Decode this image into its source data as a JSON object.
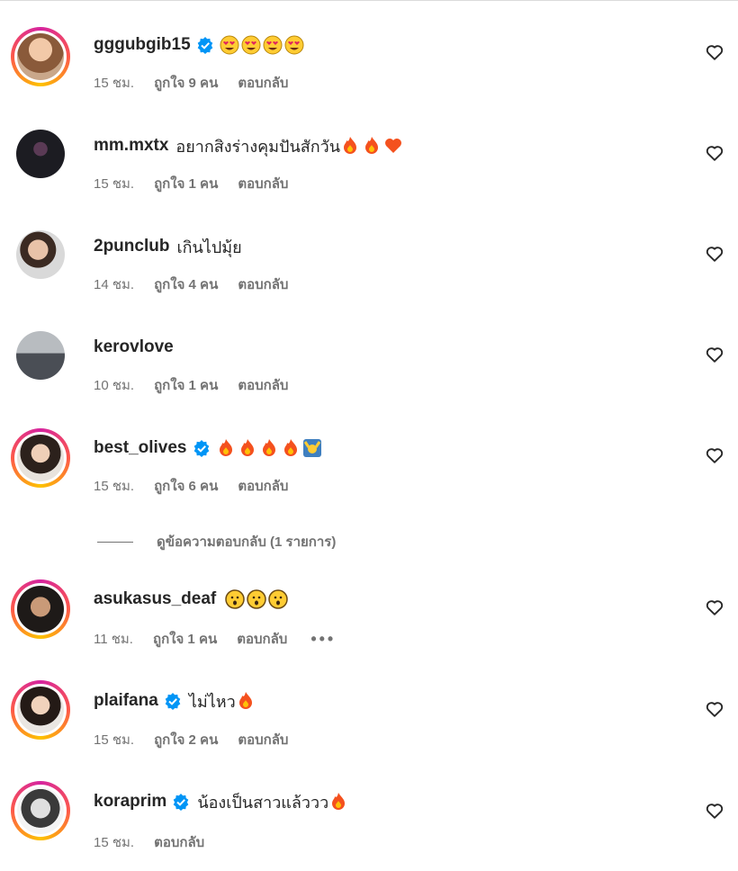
{
  "view_replies_label": "ดูข้อความตอบกลับ (1 รายการ)",
  "colors": {
    "verified": "#0095f6",
    "meta_text": "#737373",
    "ring_start": "#d6249f",
    "ring_end": "#fdc200"
  },
  "comments": [
    {
      "username": "gggubgib15",
      "verified": true,
      "text": "",
      "emojis": [
        "heart-eyes",
        "heart-eyes",
        "heart-eyes",
        "heart-eyes"
      ],
      "time": "15 ชม.",
      "likes": "ถูกใจ 9 คน",
      "reply": "ตอบกลับ"
    },
    {
      "username": "mm.mxtx",
      "verified": false,
      "text": "อยากสิงร่างคุมปันสักวัน",
      "emojis": [
        "fire",
        "fire",
        "heart-orange"
      ],
      "time": "15 ชม.",
      "likes": "ถูกใจ 1 คน",
      "reply": "ตอบกลับ"
    },
    {
      "username": "2punclub",
      "verified": false,
      "text": "เกินไปมุ้ย",
      "emojis": [],
      "time": "14 ชม.",
      "likes": "ถูกใจ 4 คน",
      "reply": "ตอบกลับ"
    },
    {
      "username": "kerovlove",
      "verified": false,
      "text": "",
      "emojis": [],
      "time": "10 ชม.",
      "likes": "ถูกใจ 1 คน",
      "reply": "ตอบกลับ"
    },
    {
      "username": "best_olives",
      "verified": true,
      "text": "",
      "emojis": [
        "fire",
        "fire",
        "fire",
        "fire",
        "raising-hands"
      ],
      "time": "15 ชม.",
      "likes": "ถูกใจ 6 คน",
      "reply": "ตอบกลับ"
    },
    {
      "username": "asukasus_deaf",
      "verified": false,
      "text": "",
      "emojis": [
        "surprised",
        "surprised",
        "surprised"
      ],
      "time": "11 ชม.",
      "likes": "ถูกใจ 1 คน",
      "reply": "ตอบกลับ",
      "more": "•••"
    },
    {
      "username": "plaifana",
      "verified": true,
      "text": "ไม่ไหว",
      "emojis": [
        "fire"
      ],
      "time": "15 ชม.",
      "likes": "ถูกใจ 2 คน",
      "reply": "ตอบกลับ"
    },
    {
      "username": "koraprim",
      "verified": true,
      "text": "น้องเป็นสาวแล้ววว",
      "emojis": [
        "fire"
      ],
      "time": "15 ชม.",
      "likes": "",
      "reply": "ตอบกลับ"
    }
  ]
}
